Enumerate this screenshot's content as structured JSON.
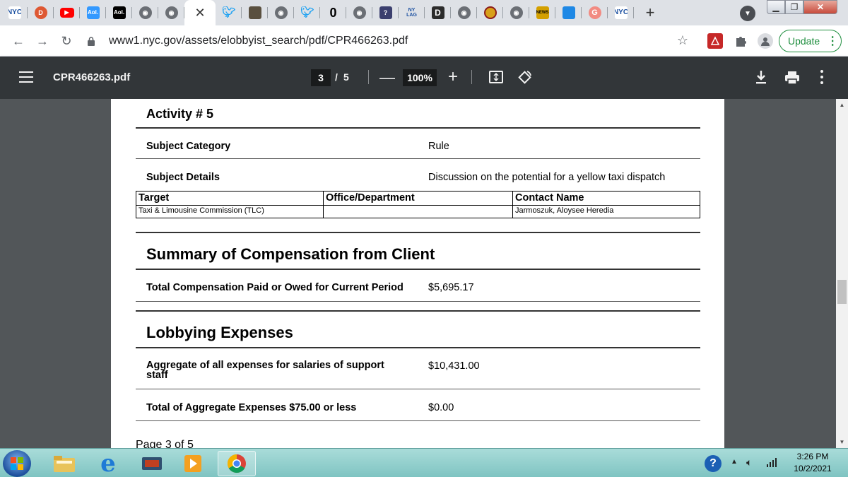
{
  "browser": {
    "tabs": [
      {
        "icon": "nyc-logo-icon"
      },
      {
        "icon": "duckduckgo-icon"
      },
      {
        "icon": "youtube-icon"
      },
      {
        "icon": "aol-icon",
        "text": "Aol."
      },
      {
        "icon": "aol-icon",
        "text": "Aol."
      },
      {
        "icon": "globe-icon"
      },
      {
        "icon": "globe-icon"
      }
    ],
    "active_tab_icon": "close-icon",
    "tabs_after": [
      {
        "icon": "twitter-icon"
      },
      {
        "icon": "image-thumb-icon"
      },
      {
        "icon": "globe-icon"
      },
      {
        "icon": "twitter-icon"
      },
      {
        "icon": "bold-o-icon",
        "text": "0"
      },
      {
        "icon": "globe-icon"
      },
      {
        "icon": "help-book-icon"
      },
      {
        "icon": "nylag-icon",
        "text": "NY LAG"
      },
      {
        "icon": "docs-icon",
        "text": "D"
      },
      {
        "icon": "globe-icon"
      },
      {
        "icon": "gear-badge-icon"
      },
      {
        "icon": "globe-icon"
      },
      {
        "icon": "news-icon",
        "text": "NEWS"
      },
      {
        "icon": "blue-square-icon"
      },
      {
        "icon": "google-icon",
        "text": "G"
      },
      {
        "icon": "nyc-logo-icon"
      }
    ],
    "new_tab_label": "+",
    "url": "www1.nyc.gov/assets/elobbyist_search/pdf/CPR466263.pdf",
    "update_label": "Update"
  },
  "pdf_toolbar": {
    "filename": "CPR466263.pdf",
    "current_page": "3",
    "page_separator": "/",
    "total_pages": "5",
    "zoom": "100%"
  },
  "document": {
    "activity_heading": "Activity # 5",
    "subject_category_label": "Subject Category",
    "subject_category_value": "Rule",
    "subject_details_label": "Subject Details",
    "subject_details_value": "Discussion on the potential for a yellow taxi dispatch",
    "target_table": {
      "headers": [
        "Target",
        "Office/Department",
        "Contact Name"
      ],
      "row": [
        "Taxi & Limousine Commission (TLC)",
        "",
        "Jarmoszuk, Aloysee Heredia"
      ]
    },
    "compensation_heading": "Summary of Compensation from Client",
    "total_comp_label": "Total Compensation Paid or Owed for Current Period",
    "total_comp_value": "$5,695.17",
    "expenses_heading": "Lobbying Expenses",
    "aggregate_label_line1": "Aggregate of all expenses for salaries of support",
    "aggregate_label_line2": "staff",
    "aggregate_value": "$10,431.00",
    "total_aggregate_label": "Total of Aggregate Expenses $75.00 or less",
    "total_aggregate_value": "$0.00",
    "page_footer": "Page 3 of 5"
  },
  "taskbar": {
    "apps": [
      "windows-explorer-icon",
      "internet-explorer-icon",
      "media-center-icon",
      "media-player-icon",
      "chrome-icon"
    ],
    "time": "3:26 PM",
    "date": "10/2/2021"
  }
}
